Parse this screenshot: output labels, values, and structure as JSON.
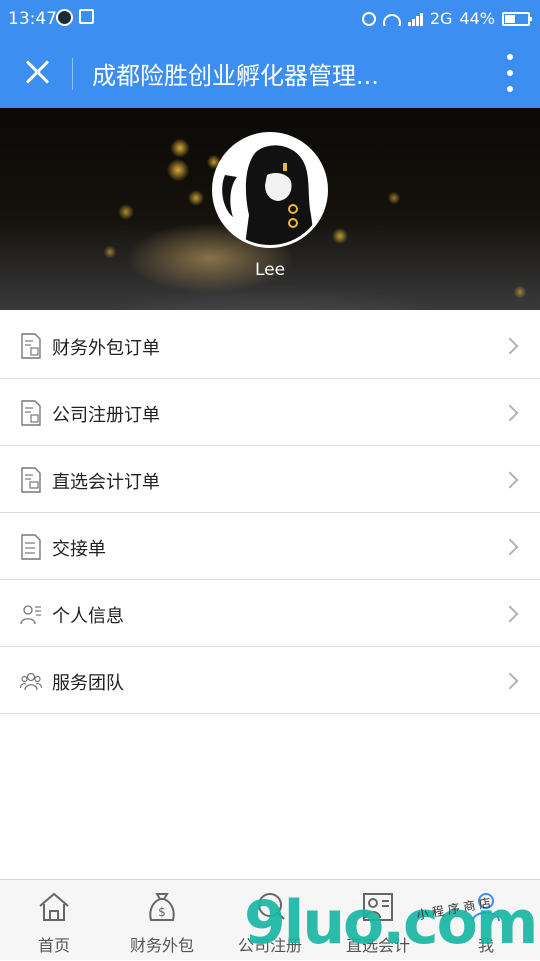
{
  "status_bar": {
    "time": "13:47",
    "network": "2G",
    "battery": "44%",
    "battery_level": 0.44
  },
  "header": {
    "title": "成都险胜创业孵化器管理..."
  },
  "profile": {
    "username": "Lee"
  },
  "menu": {
    "items": [
      {
        "label": "财务外包订单",
        "icon": "order-document-icon"
      },
      {
        "label": "公司注册订单",
        "icon": "order-document-icon"
      },
      {
        "label": "直选会计订单",
        "icon": "order-document-icon"
      },
      {
        "label": "交接单",
        "icon": "handover-list-icon"
      },
      {
        "label": "个人信息",
        "icon": "person-info-icon"
      },
      {
        "label": "服务团队",
        "icon": "team-icon"
      }
    ]
  },
  "tabs": [
    {
      "label": "首页",
      "icon": "home-icon"
    },
    {
      "label": "财务外包",
      "icon": "money-bag-icon"
    },
    {
      "label": "公司注册",
      "icon": "company-register-icon"
    },
    {
      "label": "直选会计",
      "icon": "accountant-icon"
    },
    {
      "label": "我",
      "icon": "user-icon"
    }
  ],
  "watermark": {
    "text": "9luo.com",
    "subtext": "小 程 序 商 店"
  },
  "colors": {
    "header": "#3c8ff0",
    "menu_text": "#222222",
    "divider": "#dcdcdc",
    "watermark": "#19b6a4"
  }
}
